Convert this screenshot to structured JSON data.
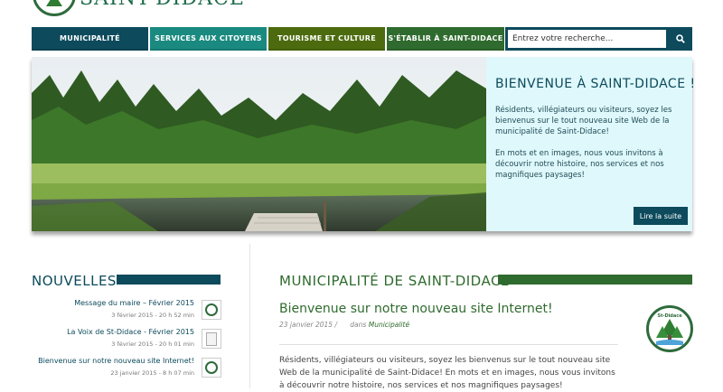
{
  "site": {
    "name": "SAINT-DIDACE"
  },
  "nav": [
    {
      "label": "MUNICIPALITÉ"
    },
    {
      "label": "SERVICES AUX CITOYENS"
    },
    {
      "label": "TOURISME ET CULTURE"
    },
    {
      "label": "S'ÉTABLIR À SAINT-DIDACE"
    }
  ],
  "search": {
    "placeholder": "Entrez votre recherche..."
  },
  "hero": {
    "title": "BIENVENUE À SAINT-DIDACE !",
    "paragraph1": "Résidents, villégiateurs ou visiteurs, soyez les bienvenus sur le tout nouveau site Web de la municipalité de Saint-Didace!",
    "paragraph2": "En mots et en images, nous vous invitons à découvrir notre histoire, nos services et nos magnifiques paysages!",
    "button": "Lire la suite"
  },
  "news": {
    "title": "NOUVELLES",
    "items": [
      {
        "title": "Message du maire – Février 2015",
        "date": "3 février 2015 - 20 h 52 min",
        "thumb": "seal"
      },
      {
        "title": "La Voix de St-Didace - Février 2015",
        "date": "3 février 2015 - 20 h 01 min",
        "thumb": "document"
      },
      {
        "title": "Bienvenue sur notre nouveau site Internet!",
        "date": "23 janvier 2015 - 8 h 07 min",
        "thumb": "seal"
      }
    ]
  },
  "main": {
    "title": "MUNICIPALITÉ DE SAINT-DIDACE",
    "post": {
      "title": "Bienvenue sur notre nouveau site Internet!",
      "date": "23 janvier 2015",
      "separator": "/",
      "in_label": "dans",
      "category": "Municipalité",
      "body": "Résidents, villégiateurs ou visiteurs, soyez les bienvenus sur le tout nouveau site Web de la municipalité de Saint-Didace! En mots et en images, nous vous invitons à découvrir notre histoire, nos services et nos magnifiques paysages!"
    },
    "seal_text": "St-Didace"
  },
  "colors": {
    "dark_blue": "#0c4a5c",
    "teal": "#1a8a80",
    "olive": "#4c6b0e",
    "green": "#2f6b2e",
    "panel": "#dff8fb"
  }
}
